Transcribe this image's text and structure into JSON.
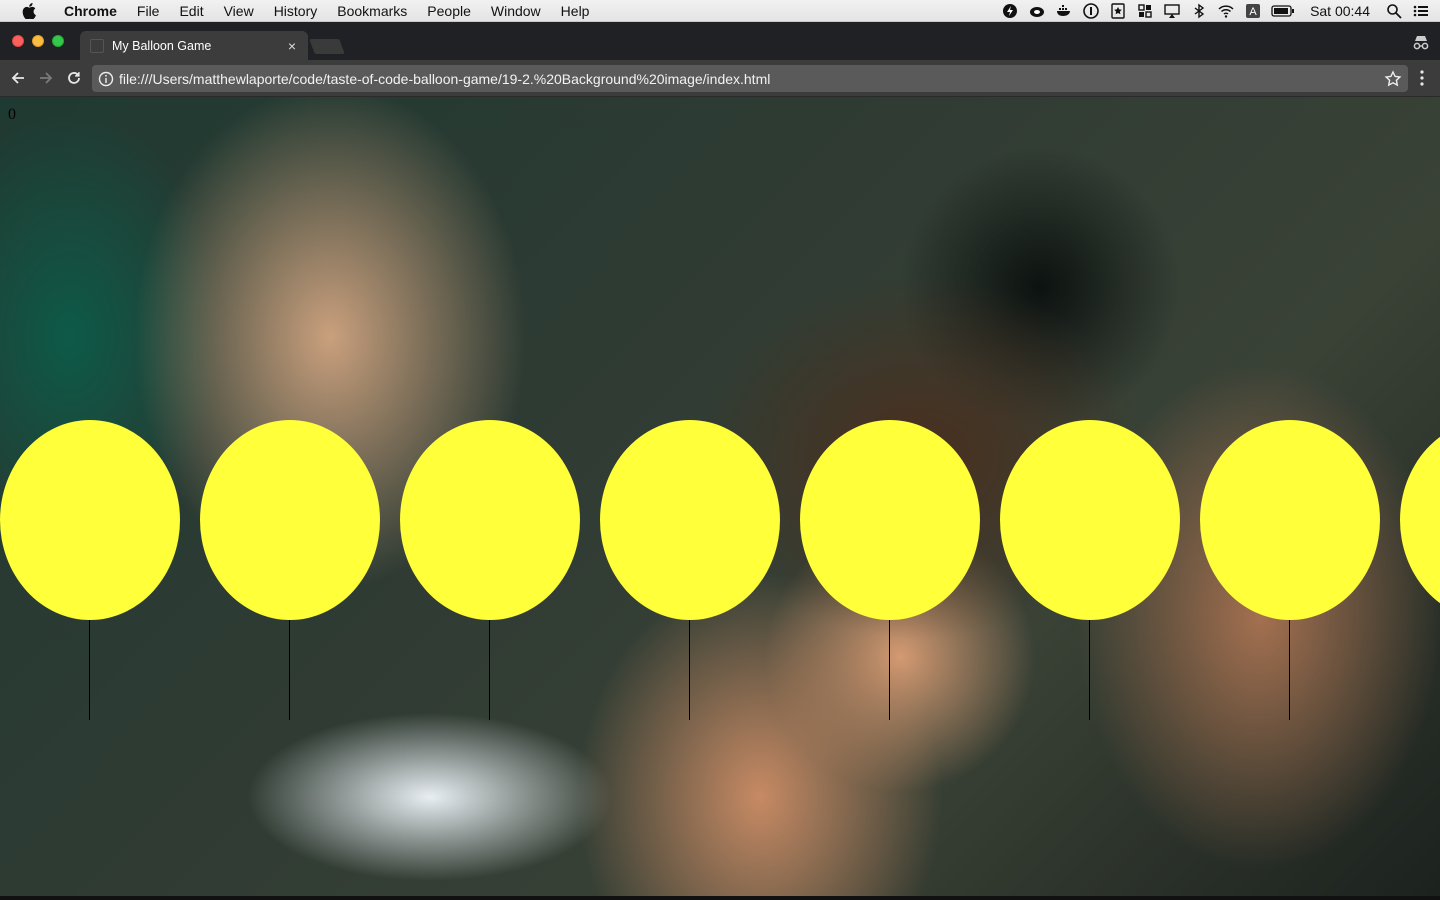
{
  "menubar": {
    "app_name": "Chrome",
    "items": [
      "File",
      "Edit",
      "View",
      "History",
      "Bookmarks",
      "People",
      "Window",
      "Help"
    ],
    "clock": "Sat 00:44",
    "tray_icons": [
      "flash-icon",
      "cloud-icon",
      "docker-icon",
      "1password-icon",
      "bookmark-icon",
      "grid-icon",
      "airplay-icon",
      "bluetooth-icon",
      "wifi-icon",
      "keyboard-input-icon",
      "battery-icon",
      "spotlight-icon",
      "notification-center-icon"
    ],
    "input_source_letter": "A"
  },
  "browser": {
    "tab_title": "My Balloon Game",
    "tab_close": "×",
    "url": "file:///Users/matthewlaporte/code/taste-of-code-balloon-game/19-2.%20Background%20image/index.html"
  },
  "page": {
    "score": "0",
    "balloon_count": 8,
    "balloon_color": "#ffff3a",
    "string_color": "#000000"
  }
}
